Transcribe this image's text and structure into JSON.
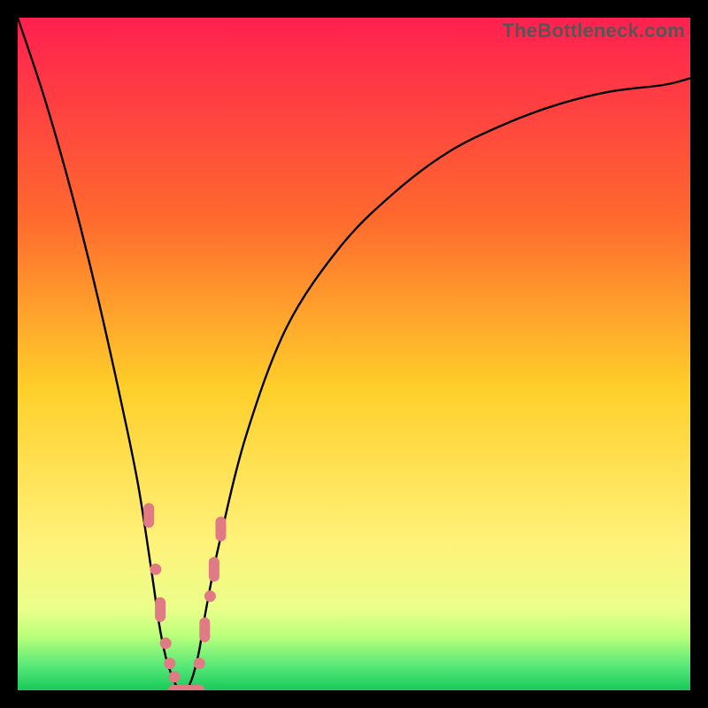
{
  "watermark": {
    "text": "TheBottleneck.com"
  },
  "colors": {
    "bg_top": "#ff2050",
    "bg_mid1": "#ff8a2a",
    "bg_mid2": "#ffe233",
    "bg_low": "#fff59a",
    "bg_band": "#eaff8a",
    "bg_green": "#22e06a",
    "curve": "#000000",
    "markers": "#e07a84"
  },
  "chart_data": {
    "type": "line",
    "title": "",
    "xlabel": "",
    "ylabel": "",
    "xlim": [
      0,
      100
    ],
    "ylim": [
      0,
      100
    ],
    "grid": false,
    "legend": false,
    "series": [
      {
        "name": "bottleneck-curve",
        "x": [
          0,
          4,
          8,
          12,
          16,
          18,
          20,
          21,
          22,
          23,
          24,
          25,
          26,
          27,
          28,
          30,
          34,
          40,
          48,
          56,
          64,
          72,
          80,
          88,
          96,
          100
        ],
        "y": [
          100,
          88,
          74,
          58,
          40,
          30,
          17,
          10,
          5,
          2,
          0,
          0,
          2,
          6,
          12,
          22,
          38,
          54,
          66,
          74,
          80,
          84,
          87,
          89,
          90,
          91
        ]
      }
    ],
    "markers": [
      {
        "x": 19.5,
        "y": 26,
        "shape": "pill-v"
      },
      {
        "x": 20.5,
        "y": 18,
        "shape": "dot"
      },
      {
        "x": 21.2,
        "y": 12,
        "shape": "pill-v"
      },
      {
        "x": 22.0,
        "y": 7,
        "shape": "dot"
      },
      {
        "x": 22.6,
        "y": 4,
        "shape": "dot"
      },
      {
        "x": 23.3,
        "y": 2,
        "shape": "dot"
      },
      {
        "x": 24.2,
        "y": 0,
        "shape": "pill-h"
      },
      {
        "x": 25.2,
        "y": 0,
        "shape": "dot"
      },
      {
        "x": 26.0,
        "y": 0,
        "shape": "pill-h"
      },
      {
        "x": 27.0,
        "y": 4,
        "shape": "dot"
      },
      {
        "x": 27.8,
        "y": 9,
        "shape": "pill-v"
      },
      {
        "x": 28.6,
        "y": 14,
        "shape": "dot"
      },
      {
        "x": 29.2,
        "y": 18,
        "shape": "pill-v"
      },
      {
        "x": 30.2,
        "y": 24,
        "shape": "pill-v"
      }
    ],
    "gradient_stops": [
      {
        "offset": 0.0,
        "color": "#ff2050"
      },
      {
        "offset": 0.3,
        "color": "#ff6a2e"
      },
      {
        "offset": 0.55,
        "color": "#ffcf2a"
      },
      {
        "offset": 0.78,
        "color": "#fff27a"
      },
      {
        "offset": 0.88,
        "color": "#eaff8a"
      },
      {
        "offset": 0.92,
        "color": "#b8ff7a"
      },
      {
        "offset": 0.965,
        "color": "#55e877"
      },
      {
        "offset": 1.0,
        "color": "#18c95a"
      }
    ]
  }
}
